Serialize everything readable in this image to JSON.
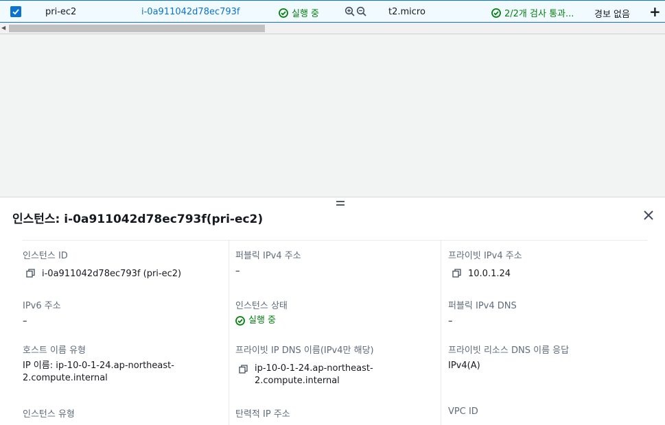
{
  "row": {
    "name": "pri-ec2",
    "instance_id": "i-0a911042d78ec793f",
    "state": "실행 중",
    "type": "t2.micro",
    "status_check": "2/2개 검사 통과...",
    "alarm": "경보 없음",
    "plus": "+"
  },
  "panel": {
    "title": "인스턴스: i-0a911042d78ec793f(pri-ec2)",
    "fields": {
      "instance_id_label": "인스턴스 ID",
      "instance_id_value": "i-0a911042d78ec793f (pri-ec2)",
      "public_ipv4_label": "퍼블릭 IPv4 주소",
      "public_ipv4_value": "–",
      "private_ipv4_label": "프라이빗 IPv4 주소",
      "private_ipv4_value": "10.0.1.24",
      "ipv6_label": "IPv6 주소",
      "ipv6_value": "–",
      "instance_state_label": "인스턴스 상태",
      "instance_state_value": "실행 중",
      "public_dns_label": "퍼블릭 IPv4 DNS",
      "public_dns_value": "–",
      "hostname_type_label": "호스트 이름 유형",
      "hostname_type_value": "IP 이름: ip-10-0-1-24.ap-northeast-2.compute.internal",
      "private_dns_label": "프라이빗 IP DNS 이름(IPv4만 해당)",
      "private_dns_value": "ip-10-0-1-24.ap-northeast-2.compute.internal",
      "resource_dns_label": "프라이빗 리소스 DNS 이름 응답",
      "resource_dns_value": "IPv4(A)",
      "instance_type_label": "인스턴스 유형",
      "elastic_ip_label": "탄력적 IP 주소",
      "vpc_id_label": "VPC ID"
    }
  },
  "colors": {
    "accent": "#0972d3",
    "success": "#037f0c",
    "label": "#5f6b7a"
  }
}
